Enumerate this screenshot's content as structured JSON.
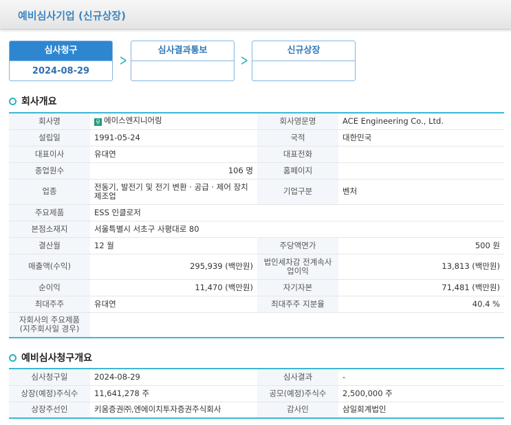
{
  "title": "예비심사기업 (신규상장)",
  "steps": [
    {
      "label": "심사청구",
      "date": "2024-08-29"
    },
    {
      "label": "심사결과통보",
      "date": ""
    },
    {
      "label": "신규상장",
      "date": ""
    }
  ],
  "overview": {
    "heading": "회사개요",
    "badge": "유",
    "rows": [
      [
        "회사명",
        "에이스엔지니어링",
        "회사영문명",
        "ACE Engineering Co., Ltd."
      ],
      [
        "설립일",
        "1991-05-24",
        "국적",
        "대한민국"
      ],
      [
        "대표이사",
        "유대연",
        "대표전화",
        ""
      ],
      [
        "종업원수",
        "106 명",
        "홈페이지",
        ""
      ],
      [
        "업종",
        "전동기, 발전기 및 전기 변환 · 공급 · 제어 장치 제조업",
        "기업구분",
        "벤처"
      ],
      [
        "주요제품",
        "ESS 인클로저"
      ],
      [
        "본점소재지",
        "서울특별시 서초구 사평대로 80"
      ],
      [
        "결산월",
        "12 월",
        "주당액면가",
        "500 원"
      ],
      [
        "매출액(수익)",
        "295,939 (백만원)",
        "법인세차감 전계속사업이익",
        "13,813 (백만원)"
      ],
      [
        "순이익",
        "11,470 (백만원)",
        "자기자본",
        "71,481 (백만원)"
      ],
      [
        "최대주주",
        "유대연",
        "최대주주 지분율",
        "40.4 %"
      ],
      [
        "자회사의 주요제품 (지주회사일 경우)",
        ""
      ]
    ]
  },
  "request": {
    "heading": "예비심사청구개요",
    "rows": [
      [
        "심사청구일",
        "2024-08-29",
        "심사결과",
        "-"
      ],
      [
        "상장(예정)주식수",
        "11,641,278 주",
        "공모(예정)주식수",
        "2,500,000 주"
      ],
      [
        "상장주선인",
        "키움증권㈜,엔에이치투자증권주식회사",
        "감사인",
        "삼일회계법인"
      ]
    ]
  }
}
